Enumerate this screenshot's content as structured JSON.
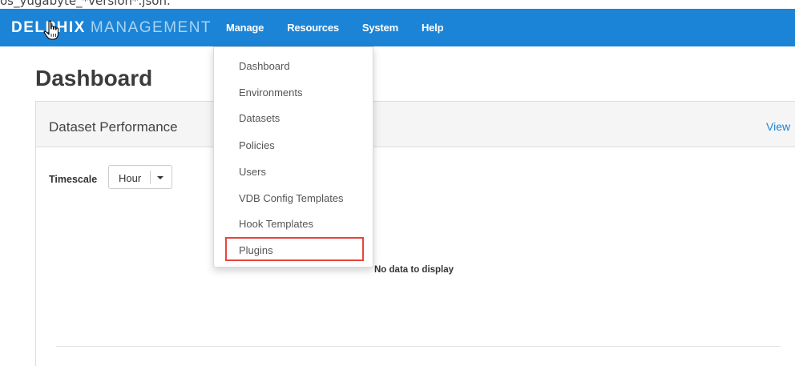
{
  "caption": "os_yugabyte_*version*.json.",
  "brand": {
    "bold": "DELPHIX",
    "light": "MANAGEMENT"
  },
  "nav": [
    "Manage",
    "Resources",
    "System",
    "Help"
  ],
  "page_title": "Dashboard",
  "panel": {
    "title": "Dataset Performance",
    "view_link": "View"
  },
  "timescale": {
    "label": "Timescale",
    "value": "Hour"
  },
  "empty_message": "No data to display",
  "menu": {
    "items": [
      "Dashboard",
      "Environments",
      "Datasets",
      "Policies",
      "Users",
      "VDB Config Templates",
      "Hook Templates",
      "Plugins"
    ],
    "highlighted": "Plugins"
  },
  "colors": {
    "nav_bg": "#1c84d6",
    "highlight": "#e8453c",
    "link": "#1c84d6"
  },
  "icons": {
    "cursor": "hand-pointer-icon",
    "caret": "caret-down-icon"
  }
}
